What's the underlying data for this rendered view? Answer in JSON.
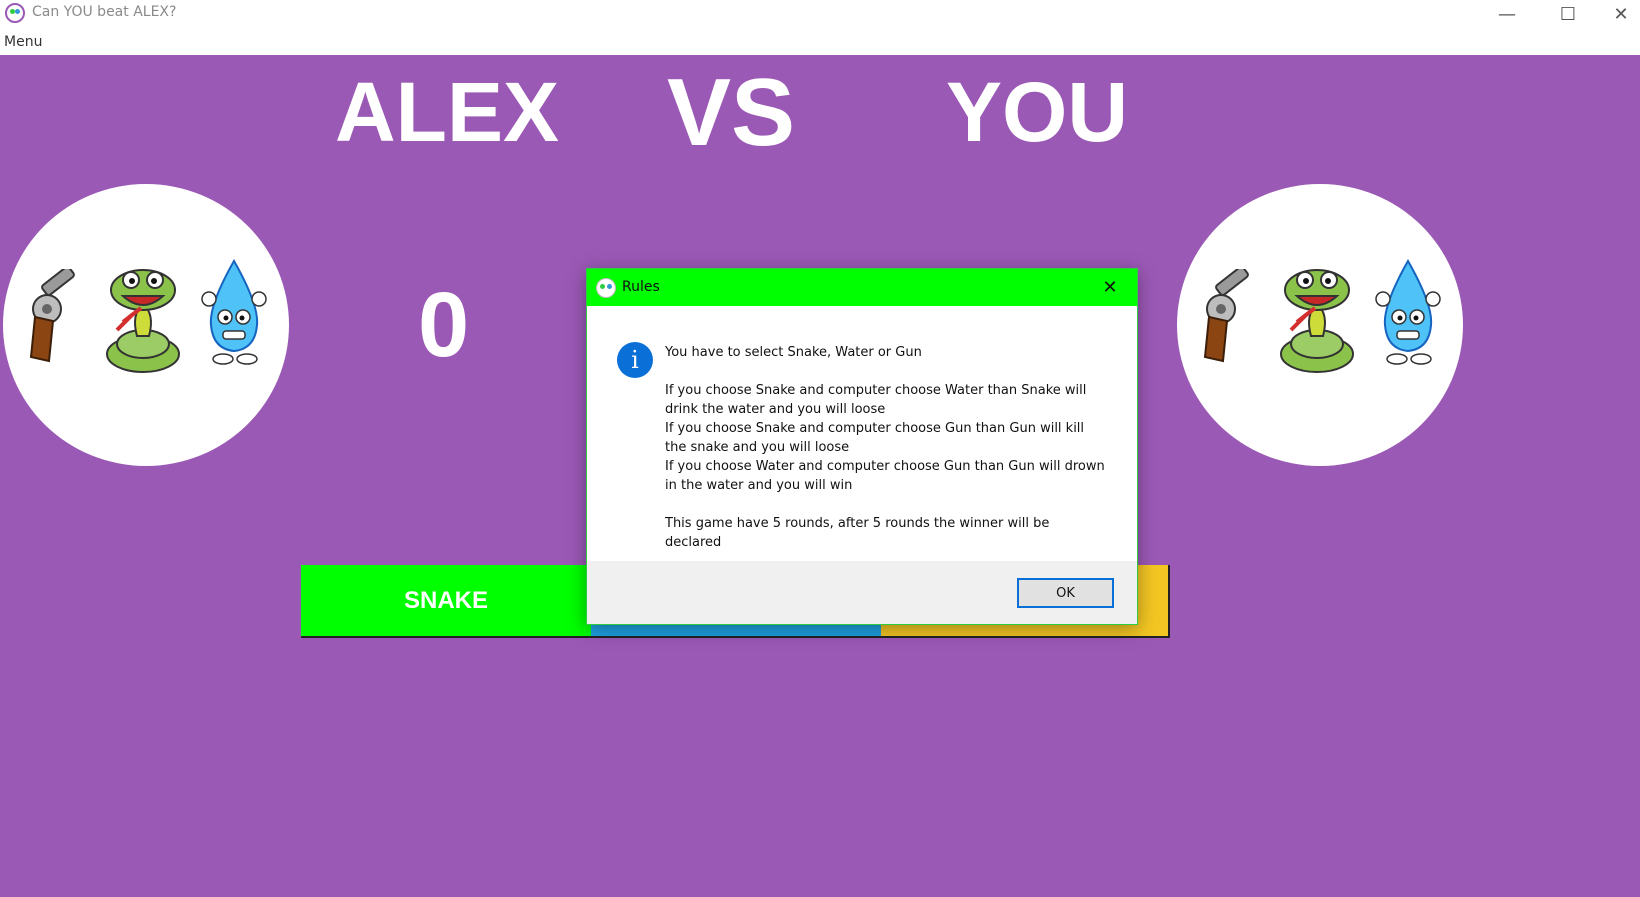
{
  "window": {
    "title": "Can YOU beat ALEX?",
    "minimize": "—",
    "maximize": "☐",
    "close": "✕",
    "menu": "Menu"
  },
  "game": {
    "player_left": "ALEX",
    "vs": "VS",
    "player_right": "YOU",
    "score_left": "0",
    "background_color": "#9b59b6",
    "choices": [
      {
        "label": "SNAKE",
        "color": "#00ff00"
      },
      {
        "label": "",
        "color": "#1ea1e0"
      },
      {
        "label": "",
        "color": "#f3c623"
      }
    ],
    "choice_icons": [
      "gun-icon",
      "snake-icon",
      "water-drop-icon"
    ]
  },
  "dialog": {
    "title": "Rules",
    "close": "✕",
    "info_glyph": "i",
    "lines": [
      "You have to select Snake, Water or Gun",
      "If you choose Snake and computer choose Water than Snake will drink the water and you will loose",
      "If you choose Snake and computer choose Gun than Gun will kill the snake and you will loose",
      "If you choose Water and computer choose Gun than Gun will drown in the water and you will win",
      "This game have 5 rounds, after 5 rounds the winner will be declared"
    ],
    "ok": "OK",
    "title_color": "#00ff00"
  }
}
